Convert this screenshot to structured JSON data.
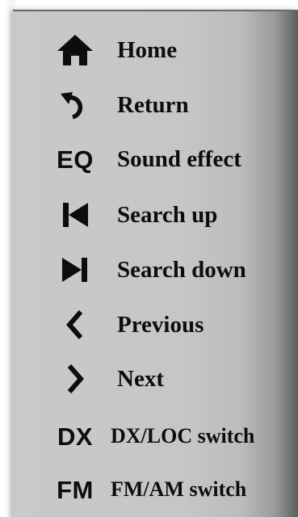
{
  "menu": {
    "items": [
      {
        "icon": "home-icon",
        "label": "Home"
      },
      {
        "icon": "return-icon",
        "label": "Return"
      },
      {
        "icon": "eq-icon",
        "icon_text": "EQ",
        "label": "Sound effect"
      },
      {
        "icon": "skip-back-icon",
        "label": "Search up"
      },
      {
        "icon": "skip-forward-icon",
        "label": "Search down"
      },
      {
        "icon": "chevron-left-icon",
        "label": "Previous"
      },
      {
        "icon": "chevron-right-icon",
        "label": "Next"
      },
      {
        "icon": "dx-icon",
        "icon_text": "DX",
        "label": "DX/LOC switch"
      },
      {
        "icon": "fm-icon",
        "icon_text": "FM",
        "label": "FM/AM switch"
      }
    ]
  },
  "colors": {
    "panel": "#c6c6c6",
    "text": "#0d0d0d"
  }
}
